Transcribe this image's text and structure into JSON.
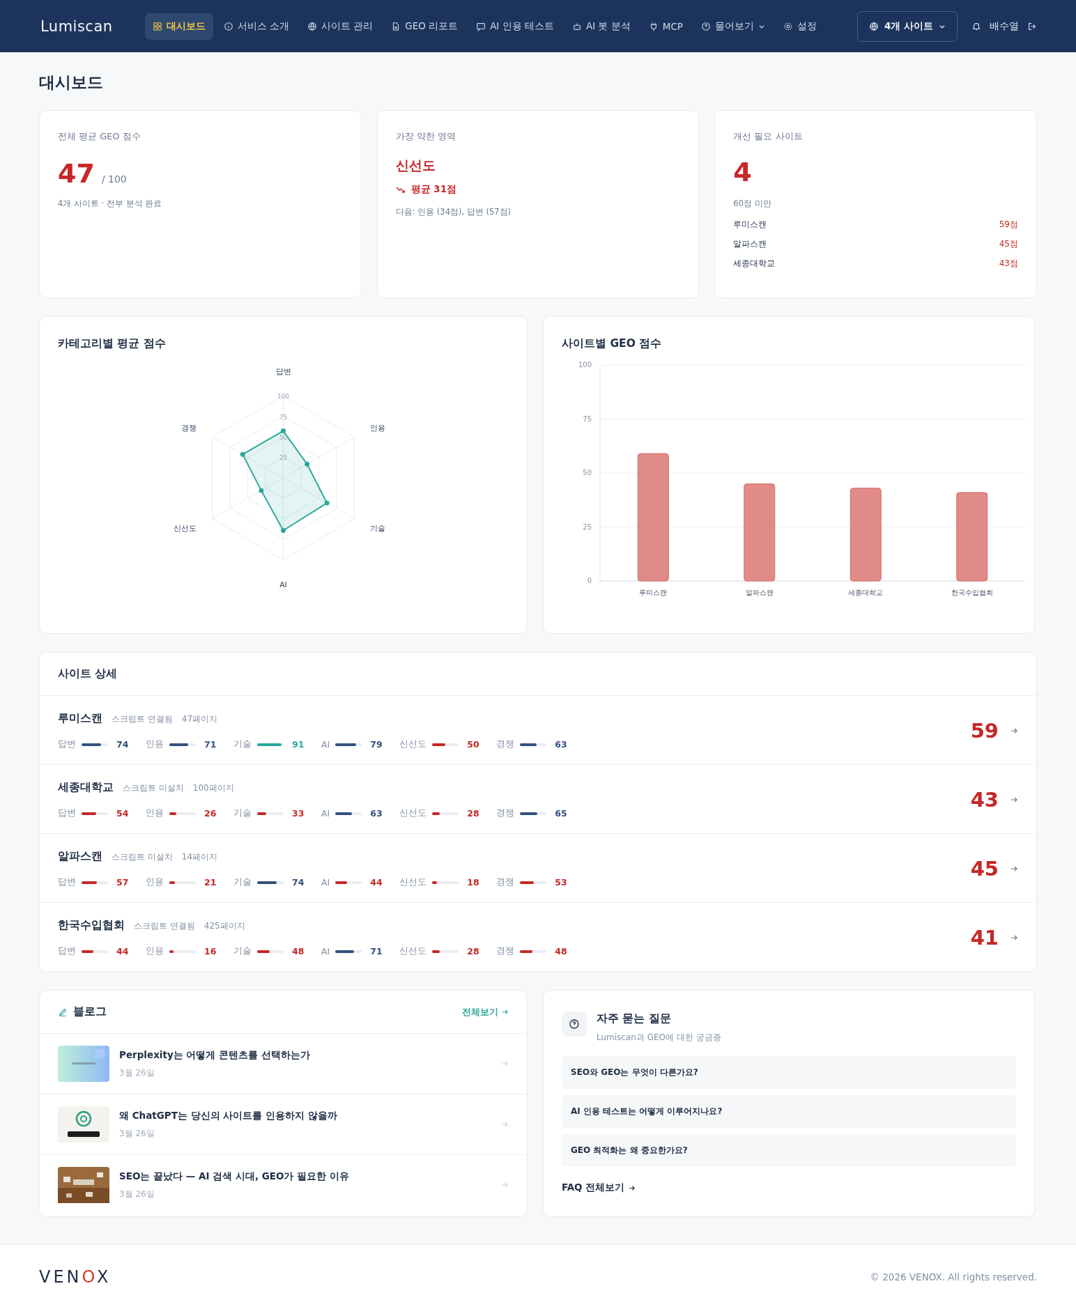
{
  "nav": {
    "logo": "Lumiscan",
    "items": [
      {
        "label": "대시보드",
        "selected": true,
        "dropdown": false
      },
      {
        "label": "서비스 소개",
        "selected": false,
        "dropdown": false
      },
      {
        "label": "사이트 관리",
        "selected": false,
        "dropdown": false
      },
      {
        "label": "GEO 리포트",
        "selected": false,
        "dropdown": false
      },
      {
        "label": "AI 인용 테스트",
        "selected": false,
        "dropdown": false
      },
      {
        "label": "AI 봇 분석",
        "selected": false,
        "dropdown": false
      },
      {
        "label": "MCP",
        "selected": false,
        "dropdown": false
      },
      {
        "label": "물어보기",
        "selected": false,
        "dropdown": true
      },
      {
        "label": "설정",
        "selected": false,
        "dropdown": false
      }
    ],
    "site_selector": "4개 사이트",
    "user": "배수열"
  },
  "page_title": "대시보드",
  "summary": {
    "average": {
      "label": "전체 평균 GEO 점수",
      "value": "47",
      "max": "/ 100",
      "note": "4개 사이트 · 전부 분석 완료"
    },
    "weakest": {
      "label": "가장 약한 영역",
      "area": "신선도",
      "average": "평균 31점",
      "note": "다음: 인용 (34점), 답변 (57점)"
    },
    "needs_improvement": {
      "label": "개선 필요 사이트",
      "count": "4",
      "note": "60점 미만",
      "sites": [
        {
          "name": "루미스캔",
          "score": "59점"
        },
        {
          "name": "알파스캔",
          "score": "45점"
        },
        {
          "name": "세종대학교",
          "score": "43점"
        }
      ]
    }
  },
  "category_chart": {
    "title": "카테고리별 평균 점수",
    "chart_data": {
      "type": "radar",
      "categories": [
        "답변",
        "인용",
        "기술",
        "AI",
        "신선도",
        "경쟁"
      ],
      "series": [
        {
          "color": "#2aa89a",
          "values": [
            57.25,
            33.5,
            61.5,
            64.25,
            31,
            57.25
          ]
        }
      ],
      "ylim": [
        0,
        100
      ],
      "yticks": [
        25,
        50,
        75,
        100
      ],
      "grid": true
    }
  },
  "site_chart": {
    "title": "사이트별 GEO 점수",
    "chart_data": {
      "type": "bar",
      "categories": [
        "루미스캔",
        "알파스캔",
        "세종대학교",
        "한국수입협회"
      ],
      "series": [
        {
          "color": "#e08b87",
          "values": [
            59,
            45,
            43,
            41
          ]
        }
      ],
      "ylim": [
        0,
        100
      ],
      "yticks": [
        0,
        25,
        50,
        75,
        100
      ],
      "grid": true
    }
  },
  "site_details": {
    "title": "사이트 상세",
    "sites": [
      {
        "name": "루미스캔",
        "script": "스크립트 연결됨",
        "pages": "47페이지",
        "score": "59",
        "metrics": [
          {
            "label": "답변",
            "value": "74",
            "level": 0.74
          },
          {
            "label": "인용",
            "value": "71",
            "level": 0.71
          },
          {
            "label": "기술",
            "value": "91",
            "level": 0.91
          },
          {
            "label": "AI",
            "value": "79",
            "level": 0.79
          },
          {
            "label": "신선도",
            "value": "50",
            "level": 0.5
          },
          {
            "label": "경쟁",
            "value": "63",
            "level": 0.63
          }
        ]
      },
      {
        "name": "세종대학교",
        "script": "스크립트 미설치",
        "pages": "100페이지",
        "score": "43",
        "metrics": [
          {
            "label": "답변",
            "value": "54",
            "level": 0.54
          },
          {
            "label": "인용",
            "value": "26",
            "level": 0.26
          },
          {
            "label": "기술",
            "value": "33",
            "level": 0.33
          },
          {
            "label": "AI",
            "value": "63",
            "level": 0.63
          },
          {
            "label": "신선도",
            "value": "28",
            "level": 0.28
          },
          {
            "label": "경쟁",
            "value": "65",
            "level": 0.65
          }
        ]
      },
      {
        "name": "알파스캔",
        "script": "스크립트 미설치",
        "pages": "14페이지",
        "score": "45",
        "metrics": [
          {
            "label": "답변",
            "value": "57",
            "level": 0.57
          },
          {
            "label": "인용",
            "value": "21",
            "level": 0.21
          },
          {
            "label": "기술",
            "value": "74",
            "level": 0.74
          },
          {
            "label": "AI",
            "value": "44",
            "level": 0.44
          },
          {
            "label": "신선도",
            "value": "18",
            "level": 0.18
          },
          {
            "label": "경쟁",
            "value": "53",
            "level": 0.53
          }
        ]
      },
      {
        "name": "한국수입협회",
        "script": "스크립트 연결됨",
        "pages": "425페이지",
        "score": "41",
        "metrics": [
          {
            "label": "답변",
            "value": "44",
            "level": 0.44
          },
          {
            "label": "인용",
            "value": "16",
            "level": 0.16
          },
          {
            "label": "기술",
            "value": "48",
            "level": 0.48
          },
          {
            "label": "AI",
            "value": "71",
            "level": 0.71
          },
          {
            "label": "신선도",
            "value": "28",
            "level": 0.28
          },
          {
            "label": "경쟁",
            "value": "48",
            "level": 0.48
          }
        ]
      }
    ]
  },
  "blog": {
    "title": "블로그",
    "view_all": "전체보기",
    "posts": [
      {
        "title": "Perplexity는 어떻게 콘텐츠를 선택하는가",
        "date": "3월 26일"
      },
      {
        "title": "왜 ChatGPT는 당신의 사이트를 인용하지 않을까",
        "date": "3월 26일"
      },
      {
        "title": "SEO는 끝났다 — AI 검색 시대, GEO가 필요한 이유",
        "date": "3월 26일"
      }
    ]
  },
  "faq": {
    "title": "자주 묻는 질문",
    "subtitle": "Lumiscan과 GEO에 대한 궁금증",
    "questions": [
      "SEO와 GEO는 무엇이 다른가요?",
      "AI 인용 테스트는 어떻게 이루어지나요?",
      "GEO 최적화는 왜 중요한가요?"
    ],
    "view_all": "FAQ 전체보기"
  },
  "footer": {
    "logo": "VENOX",
    "copyright": "© 2026 VENOX. All rights reserved."
  }
}
